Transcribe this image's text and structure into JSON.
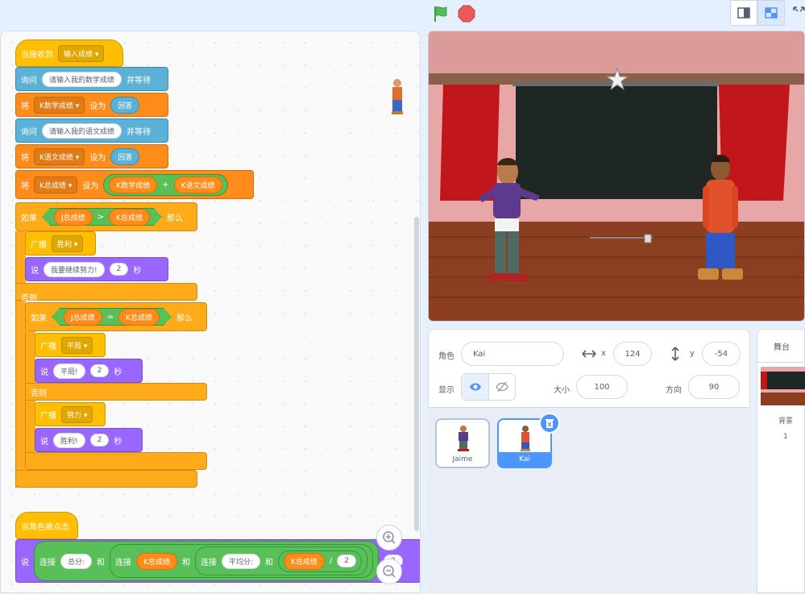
{
  "toolbar": {
    "green_flag": "green-flag-icon",
    "stop": "stop-icon"
  },
  "code": {
    "script1": {
      "hat": {
        "label": "当接收到",
        "message": "输入成绩"
      },
      "ask1": {
        "label": "询问",
        "text": "请输入我的数学成绩",
        "suffix": "并等待"
      },
      "set1": {
        "label": "将",
        "var": "K数学成绩",
        "mid": "设为",
        "value": "回答"
      },
      "ask2": {
        "label": "询问",
        "text": "请输入我的语文成绩",
        "suffix": "并等待"
      },
      "set2": {
        "label": "将",
        "var": "K语文成绩",
        "mid": "设为",
        "value": "回答"
      },
      "set3": {
        "label": "将",
        "var": "K总成绩",
        "mid": "设为",
        "a": "K数学成绩",
        "op": "+",
        "b": "K语文成绩"
      },
      "if1": {
        "label": "如果",
        "a": "J总成绩",
        "op": ">",
        "b": "K总成绩",
        "then": "那么"
      },
      "bc1": {
        "label": "广播",
        "message": "胜利"
      },
      "say1": {
        "label": "说",
        "text": "我要继续努力!",
        "secs": "2",
        "unit": "秒"
      },
      "else1": "否则",
      "if2": {
        "label": "如果",
        "a": "J总成绩",
        "op": "=",
        "b": "K总成绩",
        "then": "那么"
      },
      "bc2": {
        "label": "广播",
        "message": "平局"
      },
      "say2": {
        "label": "说",
        "text": "平局!",
        "secs": "2",
        "unit": "秒"
      },
      "else2": "否则",
      "bc3": {
        "label": "广播",
        "message": "努力"
      },
      "say3": {
        "label": "说",
        "text": "胜利!",
        "secs": "2",
        "unit": "秒"
      }
    },
    "script2": {
      "hat": "当角色被点击",
      "say": {
        "label": "说",
        "j1": "连接",
        "t1": "总分:",
        "and1": "和",
        "j2": "连接",
        "v1": "K总成绩",
        "and2": "和",
        "j3": "连接",
        "t2": "平均分:",
        "and3": "和",
        "v2": "K总成绩",
        "div": "/",
        "n": "2",
        "secs": "2"
      }
    }
  },
  "sprite_info": {
    "sprite_label": "角色",
    "sprite_name": "Kai",
    "x_label": "x",
    "x_value": "124",
    "y_label": "y",
    "y_value": "-54",
    "show_label": "显示",
    "size_label": "大小",
    "size_value": "100",
    "direction_label": "方向",
    "direction_value": "90"
  },
  "sprites": [
    {
      "name": "Jaime"
    },
    {
      "name": "Kai"
    }
  ],
  "stage_panel": {
    "tab": "舞台",
    "backdrops_label": "背景",
    "backdrops_count": "1"
  }
}
